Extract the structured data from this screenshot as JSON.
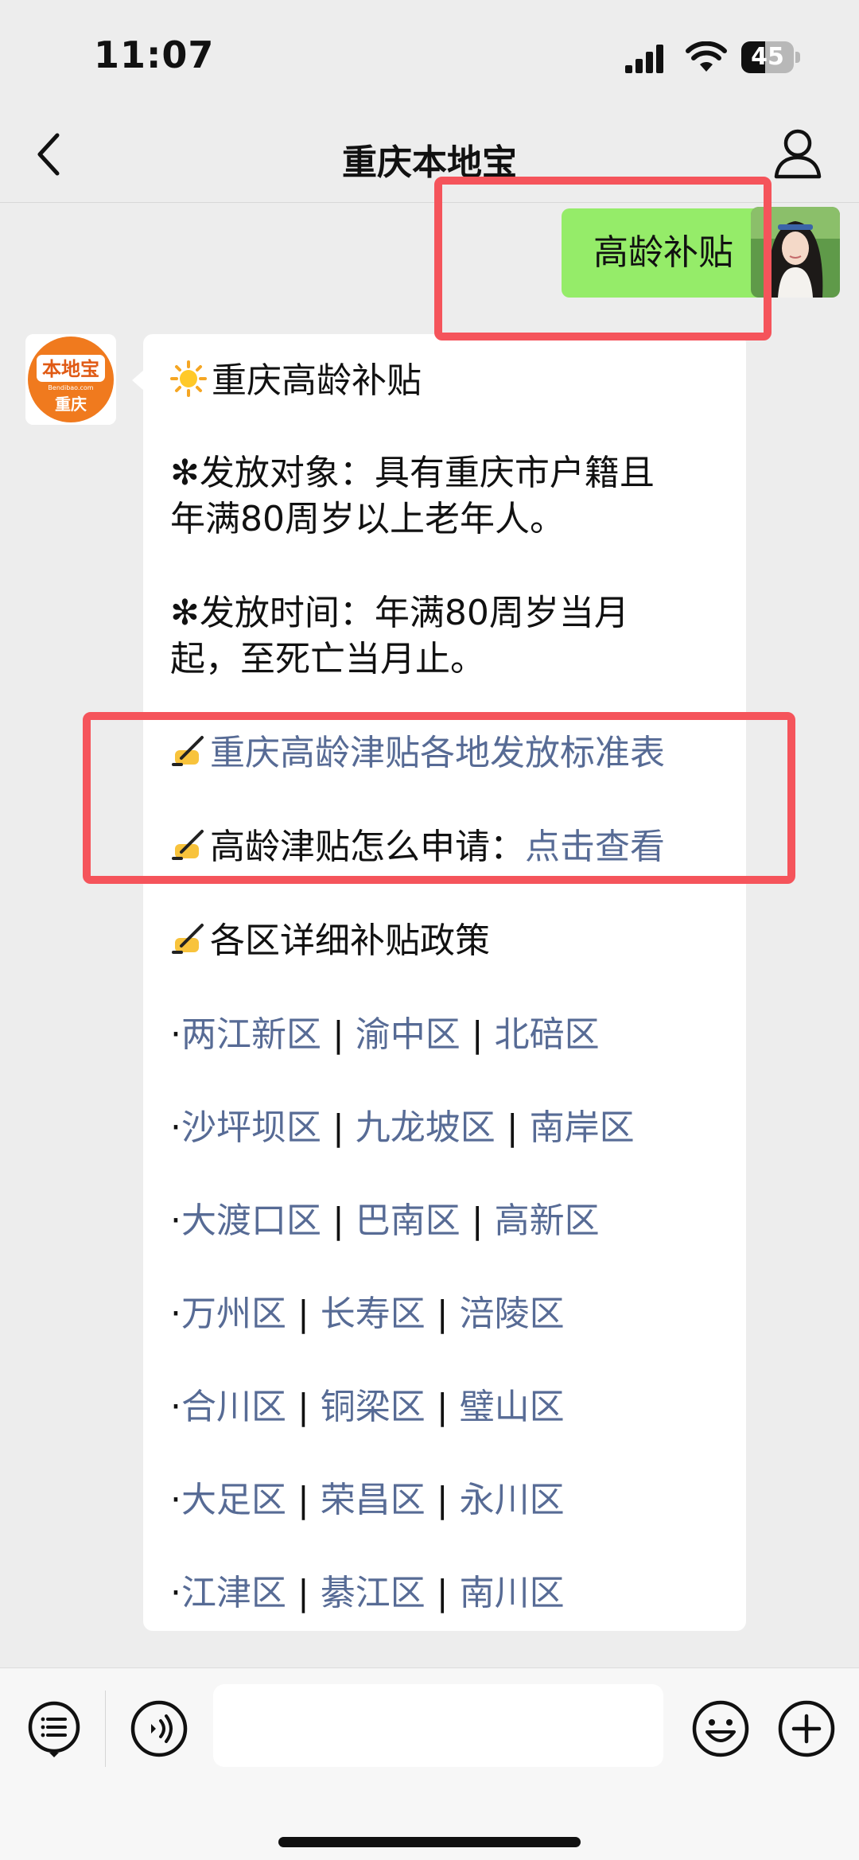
{
  "status": {
    "time": "11:07",
    "battery": "45",
    "battery_level": 0.45
  },
  "nav": {
    "title": "重庆本地宝"
  },
  "my_message": "高龄补贴",
  "bot": {
    "avatar_top": "本地宝",
    "avatar_sub": "Bendibao.com",
    "avatar_city": "重庆",
    "heading": "重庆高龄补贴",
    "target_line1": "✻发放对象：具有重庆市户籍且",
    "target_line2": "年满80周岁以上老年人。",
    "time_line1": "✻发放时间：年满80周岁当月",
    "time_line2": "起，至死亡当月止。",
    "standards_link": "重庆高龄津贴各地发放标准表",
    "apply_label": "高龄津贴怎么申请：",
    "apply_link": "点击查看",
    "districts_heading": "各区详细补贴政策",
    "rows": [
      {
        "a": "两江新区",
        "b": "渝中区",
        "c": "北碚区"
      },
      {
        "a": "沙坪坝区",
        "b": "九龙坡区",
        "c": "南岸区"
      },
      {
        "a": "大渡口区",
        "b": "巴南区",
        "c": "高新区"
      },
      {
        "a": "万州区",
        "b": "长寿区",
        "c": "涪陵区"
      },
      {
        "a": "合川区",
        "b": "铜梁区",
        "c": "璧山区"
      },
      {
        "a": "大足区",
        "b": "荣昌区",
        "c": "永川区"
      },
      {
        "a": "江津区",
        "b": "綦江区",
        "c": "南川区"
      }
    ],
    "bullet": "·",
    "separator": " | "
  }
}
